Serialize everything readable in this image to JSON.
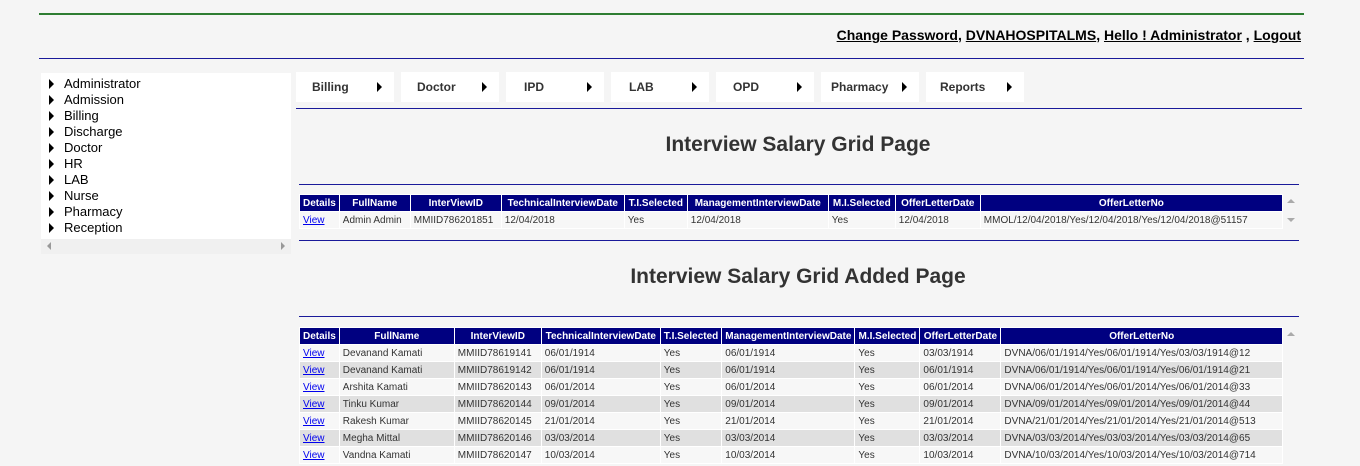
{
  "header": {
    "change_password": "Change Password",
    "hospital": "DVNAHOSPITALMS",
    "greeting": "Hello ! Administrator",
    "logout": "Logout"
  },
  "sidebar": {
    "items": [
      {
        "label": "Administrator"
      },
      {
        "label": "Admission"
      },
      {
        "label": "Billing"
      },
      {
        "label": "Discharge"
      },
      {
        "label": "Doctor"
      },
      {
        "label": "HR"
      },
      {
        "label": "LAB"
      },
      {
        "label": "Nurse"
      },
      {
        "label": "Pharmacy"
      },
      {
        "label": "Reception"
      }
    ]
  },
  "menu": {
    "items": [
      {
        "label": "Billing"
      },
      {
        "label": "Doctor"
      },
      {
        "label": "IPD"
      },
      {
        "label": "LAB"
      },
      {
        "label": "OPD"
      },
      {
        "label": "Pharmacy"
      },
      {
        "label": "Reports"
      }
    ]
  },
  "grid1": {
    "title": "Interview Salary Grid Page",
    "columns": [
      "Details",
      "FullName",
      "InterViewID",
      "TechnicalInterviewDate",
      "T.I.Selected",
      "ManagementInterviewDate",
      "M.I.Selected",
      "OfferLetterDate",
      "OfferLetterNo"
    ],
    "rows": [
      [
        "View",
        "Admin Admin",
        "MMIID786201851",
        "12/04/2018",
        "Yes",
        "12/04/2018",
        "Yes",
        "12/04/2018",
        "MMOL/12/04/2018/Yes/12/04/2018/Yes/12/04/2018@51157"
      ]
    ]
  },
  "grid2": {
    "title": "Interview Salary Grid Added Page",
    "columns": [
      "Details",
      "FullName",
      "InterViewID",
      "TechnicalInterviewDate",
      "T.I.Selected",
      "ManagementInterviewDate",
      "M.I.Selected",
      "OfferLetterDate",
      "OfferLetterNo"
    ],
    "rows": [
      [
        "View",
        "Devanand Kamati",
        "MMIID78619141",
        "06/01/1914",
        "Yes",
        "06/01/1914",
        "Yes",
        "03/03/1914",
        "DVNA/06/01/1914/Yes/06/01/1914/Yes/03/03/1914@12"
      ],
      [
        "View",
        "Devanand Kamati",
        "MMIID78619142",
        "06/01/1914",
        "Yes",
        "06/01/1914",
        "Yes",
        "06/01/1914",
        "DVNA/06/01/1914/Yes/06/01/1914/Yes/06/01/1914@21"
      ],
      [
        "View",
        "Arshita Kamati",
        "MMIID78620143",
        "06/01/2014",
        "Yes",
        "06/01/2014",
        "Yes",
        "06/01/2014",
        "DVNA/06/01/2014/Yes/06/01/2014/Yes/06/01/2014@33"
      ],
      [
        "View",
        "Tinku Kumar",
        "MMIID78620144",
        "09/01/2014",
        "Yes",
        "09/01/2014",
        "Yes",
        "09/01/2014",
        "DVNA/09/01/2014/Yes/09/01/2014/Yes/09/01/2014@44"
      ],
      [
        "View",
        "Rakesh Kumar",
        "MMIID78620145",
        "21/01/2014",
        "Yes",
        "21/01/2014",
        "Yes",
        "21/01/2014",
        "DVNA/21/01/2014/Yes/21/01/2014/Yes/21/01/2014@513"
      ],
      [
        "View",
        "Megha Mittal",
        "MMIID78620146",
        "03/03/2014",
        "Yes",
        "03/03/2014",
        "Yes",
        "03/03/2014",
        "DVNA/03/03/2014/Yes/03/03/2014/Yes/03/03/2014@65"
      ],
      [
        "View",
        "Vandna Kamati",
        "MMIID78620147",
        "10/03/2014",
        "Yes",
        "10/03/2014",
        "Yes",
        "10/03/2014",
        "DVNA/10/03/2014/Yes/10/03/2014/Yes/10/03/2014@714"
      ]
    ]
  }
}
